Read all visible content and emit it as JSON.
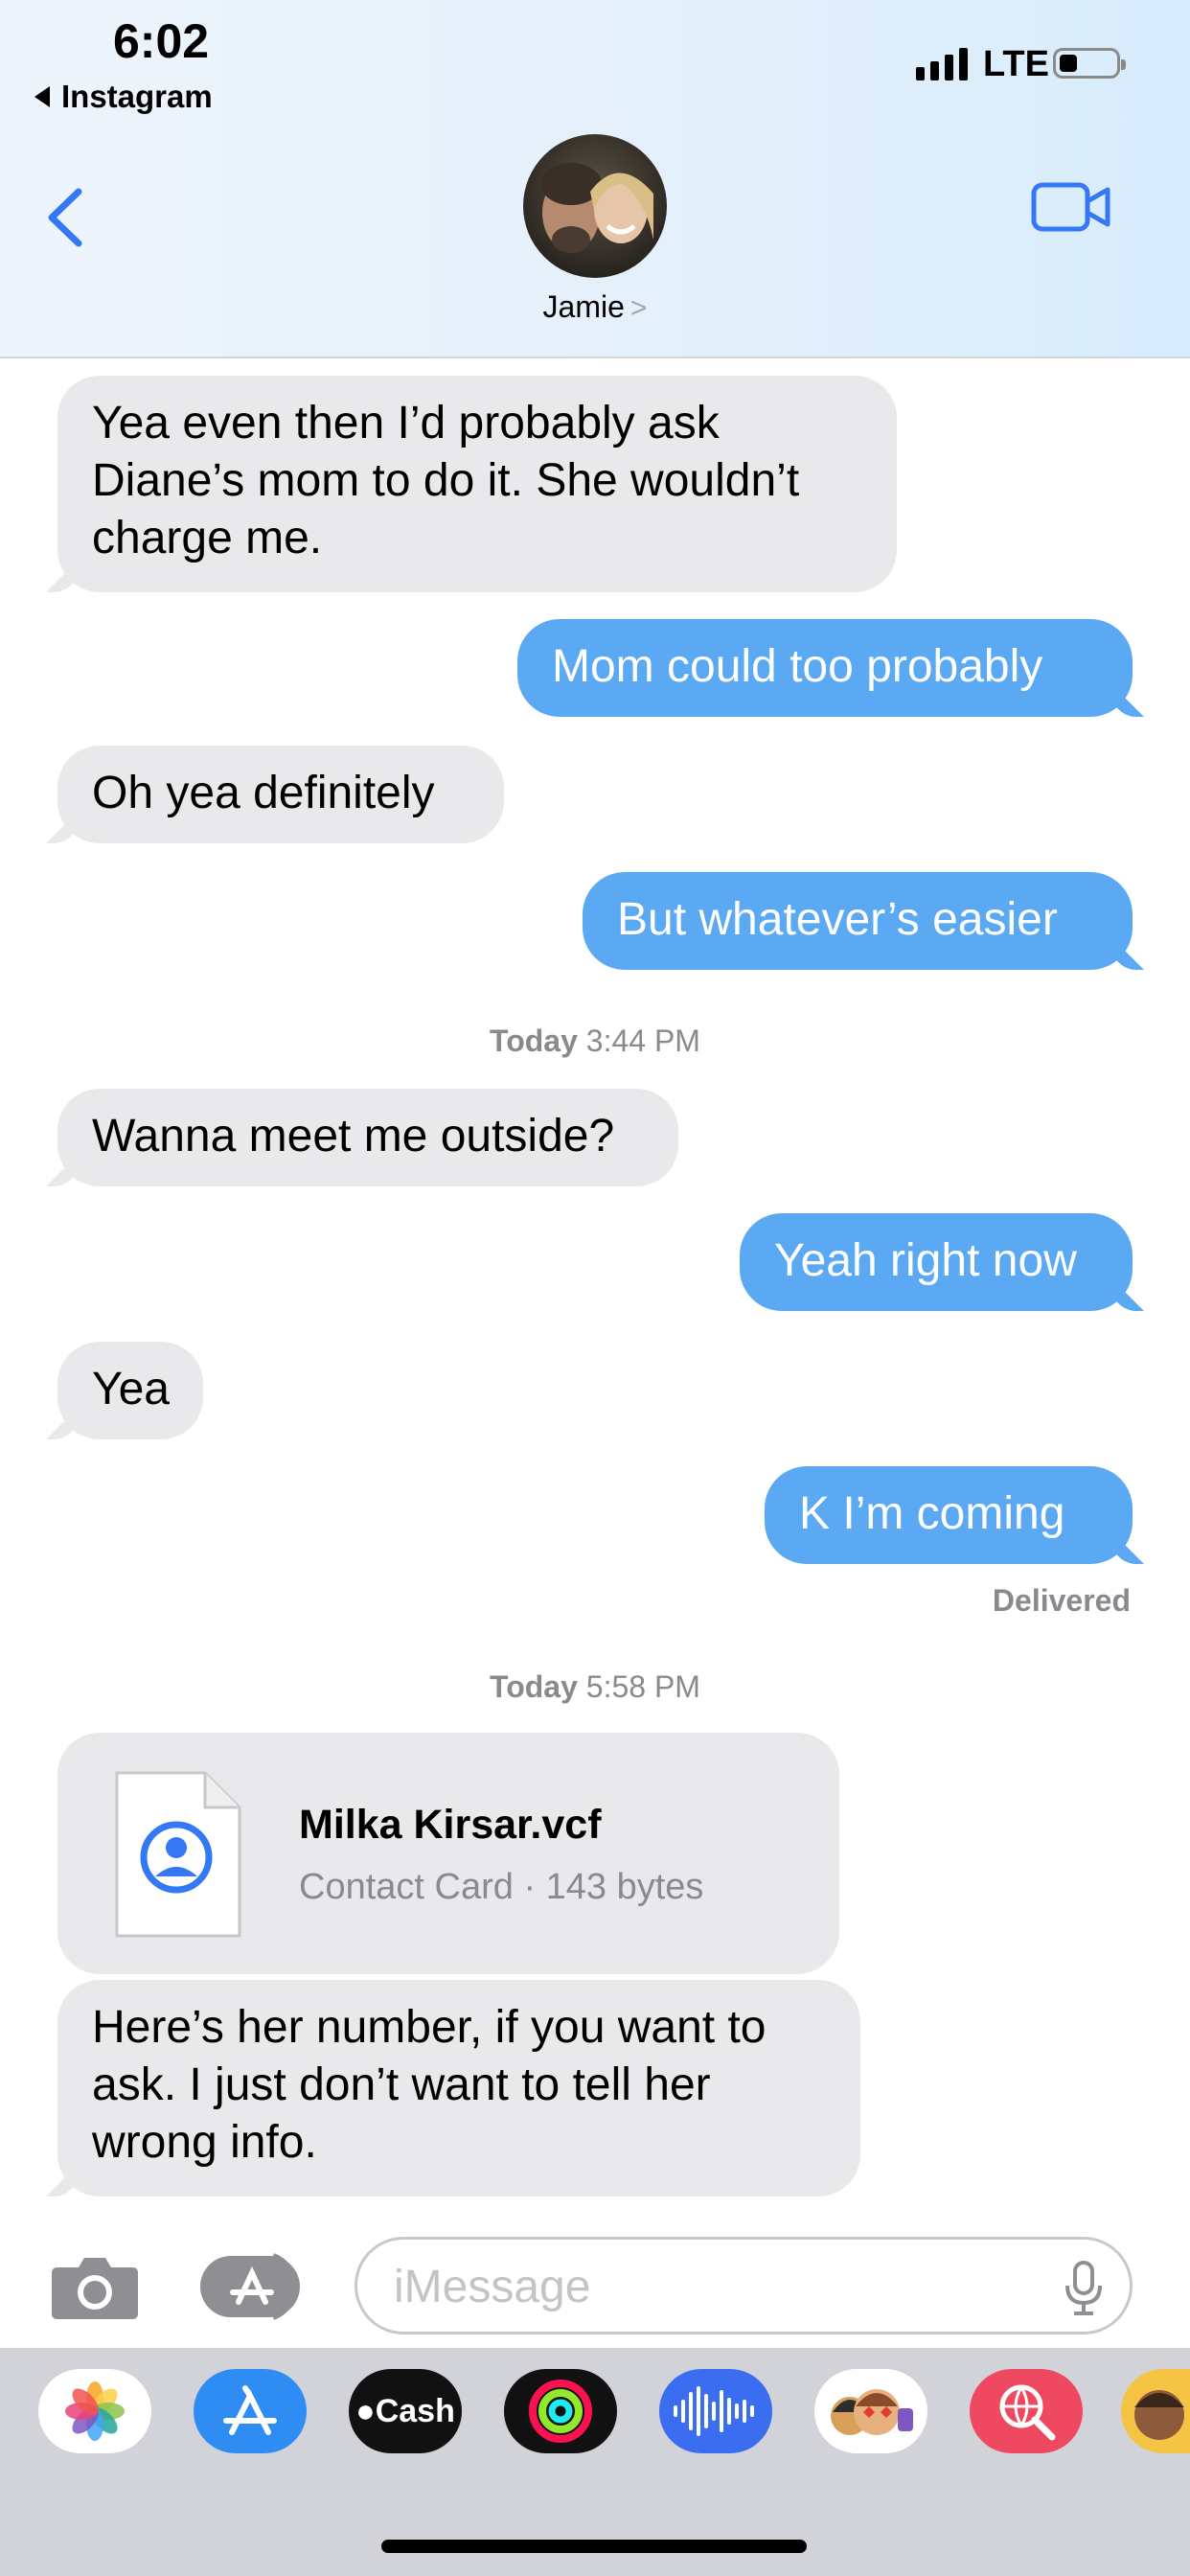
{
  "status_bar": {
    "time": "6:02",
    "back_app": "Instagram",
    "network": "LTE"
  },
  "header": {
    "contact_name": "Jamie",
    "chevron": ">"
  },
  "messages": [
    {
      "side": "received",
      "lines": [
        "Yea even then I’d probably ask",
        "Diane’s mom to do it. She wouldn’t",
        "charge me."
      ]
    },
    {
      "side": "sent",
      "text": "Mom could too probably"
    },
    {
      "side": "received",
      "text": "Oh yea definitely"
    },
    {
      "side": "sent",
      "text": "But whatever’s easier"
    },
    {
      "side": "received",
      "text": "Wanna meet me outside?"
    },
    {
      "side": "sent",
      "text": "Yeah right now"
    },
    {
      "side": "received",
      "text": "Yea"
    },
    {
      "side": "sent",
      "text": "K I’m coming"
    },
    {
      "side": "received",
      "lines": [
        "Here’s her number, if you want to",
        "ask. I just don’t want to tell her",
        "wrong info."
      ]
    }
  ],
  "timestamps": [
    {
      "day": "Today",
      "time": "3:44 PM"
    },
    {
      "day": "Today",
      "time": "5:58 PM"
    }
  ],
  "delivered_label": "Delivered",
  "attachment": {
    "file_name": "Milka Kirsar.vcf",
    "meta": "Contact Card · 143 bytes",
    "icon": "contact-card-icon"
  },
  "composer": {
    "placeholder": "iMessage"
  },
  "app_drawer": {
    "apps": [
      {
        "name": "photos",
        "icon": "photos-icon"
      },
      {
        "name": "app-store",
        "icon": "app-store-icon"
      },
      {
        "name": "apple-cash",
        "icon": "apple-cash-icon",
        "label": "Cash"
      },
      {
        "name": "activity",
        "icon": "activity-rings-icon"
      },
      {
        "name": "audio",
        "icon": "waveform-icon"
      },
      {
        "name": "memoji",
        "icon": "memoji-icon"
      },
      {
        "name": "images-search",
        "icon": "globe-search-icon"
      },
      {
        "name": "memoji-2",
        "icon": "memoji-icon"
      }
    ]
  },
  "colors": {
    "accent": "#3478f6",
    "sent_bubble": "#5aa9f2",
    "received_bubble": "#e9e9eb"
  }
}
